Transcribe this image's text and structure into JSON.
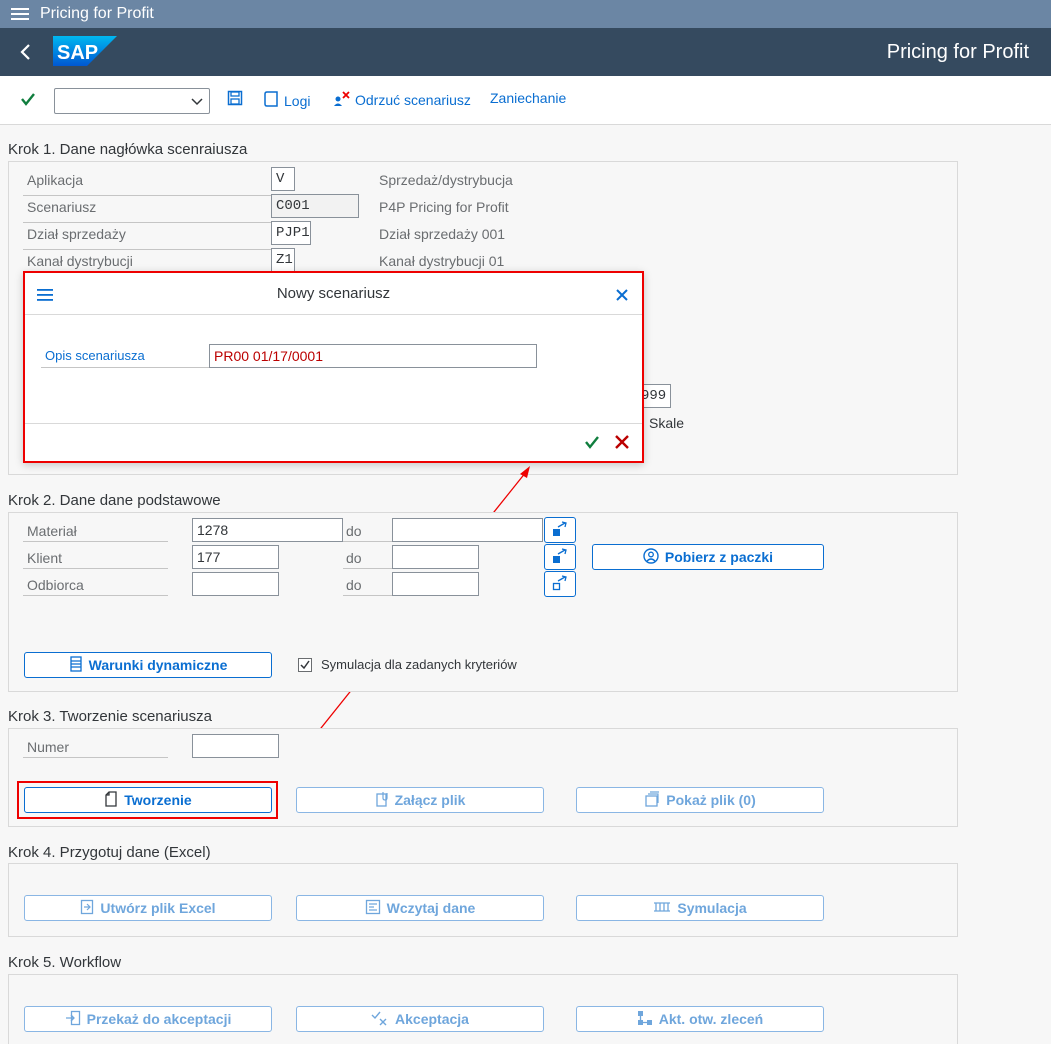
{
  "window": {
    "title": "Pricing for Profit"
  },
  "shell": {
    "logo_text": "SAP",
    "app_title": "Pricing for Profit"
  },
  "toolbar": {
    "combo_value": "",
    "logs_label": "Logi",
    "reject_label": "Odrzuć scenariusz",
    "cancel_label": "Zaniechanie"
  },
  "step1": {
    "title": "Krok 1. Dane nagłówka scenraiusza",
    "rows": [
      {
        "label": "Aplikacja",
        "value": "V",
        "desc": "Sprzedaż/dystrybucja"
      },
      {
        "label": "Scenariusz",
        "value": "C001",
        "desc": "P4P Pricing for Profit"
      },
      {
        "label": "Dział sprzedaży",
        "value": "PJP1",
        "desc": "Dział sprzedaży 001"
      },
      {
        "label": "Kanał dystrybucji",
        "value": "Z1",
        "desc": "Kanał dystrybucji 01"
      }
    ],
    "partial_value": "999",
    "partial_label": "Skale"
  },
  "dialog": {
    "title": "Nowy scenariusz",
    "field_label": "Opis scenariusza",
    "field_value": "PR00 01/17/0001"
  },
  "step2": {
    "title": "Krok 2. Dane dane podstawowe",
    "rows": [
      {
        "label": "Materiał",
        "from": "1278",
        "to_label": "do",
        "to": ""
      },
      {
        "label": "Klient",
        "from": "177",
        "to_label": "do",
        "to": ""
      },
      {
        "label": "Odbiorca",
        "from": "",
        "to_label": "do",
        "to": ""
      }
    ],
    "fetch_button": "Pobierz z paczki",
    "dynamic_button": "Warunki dynamiczne",
    "simulation_checkbox": "Symulacja dla zadanych kryteriów",
    "simulation_checked": true
  },
  "step3": {
    "title": "Krok 3. Tworzenie scenariusza",
    "number_label": "Numer",
    "number_value": "",
    "create_button": "Tworzenie",
    "attach_button": "Załącz plik",
    "show_button": "Pokaż plik (0)"
  },
  "step4": {
    "title": "Krok 4. Przygotuj dane (Excel)",
    "excel_button": "Utwórz plik Excel",
    "load_button": "Wczytaj dane",
    "simulate_button": "Symulacja"
  },
  "step5": {
    "title": "Krok 5. Workflow",
    "forward_button": "Przekaż do akceptacji",
    "accept_button": "Akceptacja",
    "orders_button": "Akt. otw. zleceń"
  },
  "colors": {
    "accent": "#0a6ed1",
    "shell": "#354a5f",
    "highlight": "#e00000",
    "positive": "#107e3e"
  }
}
